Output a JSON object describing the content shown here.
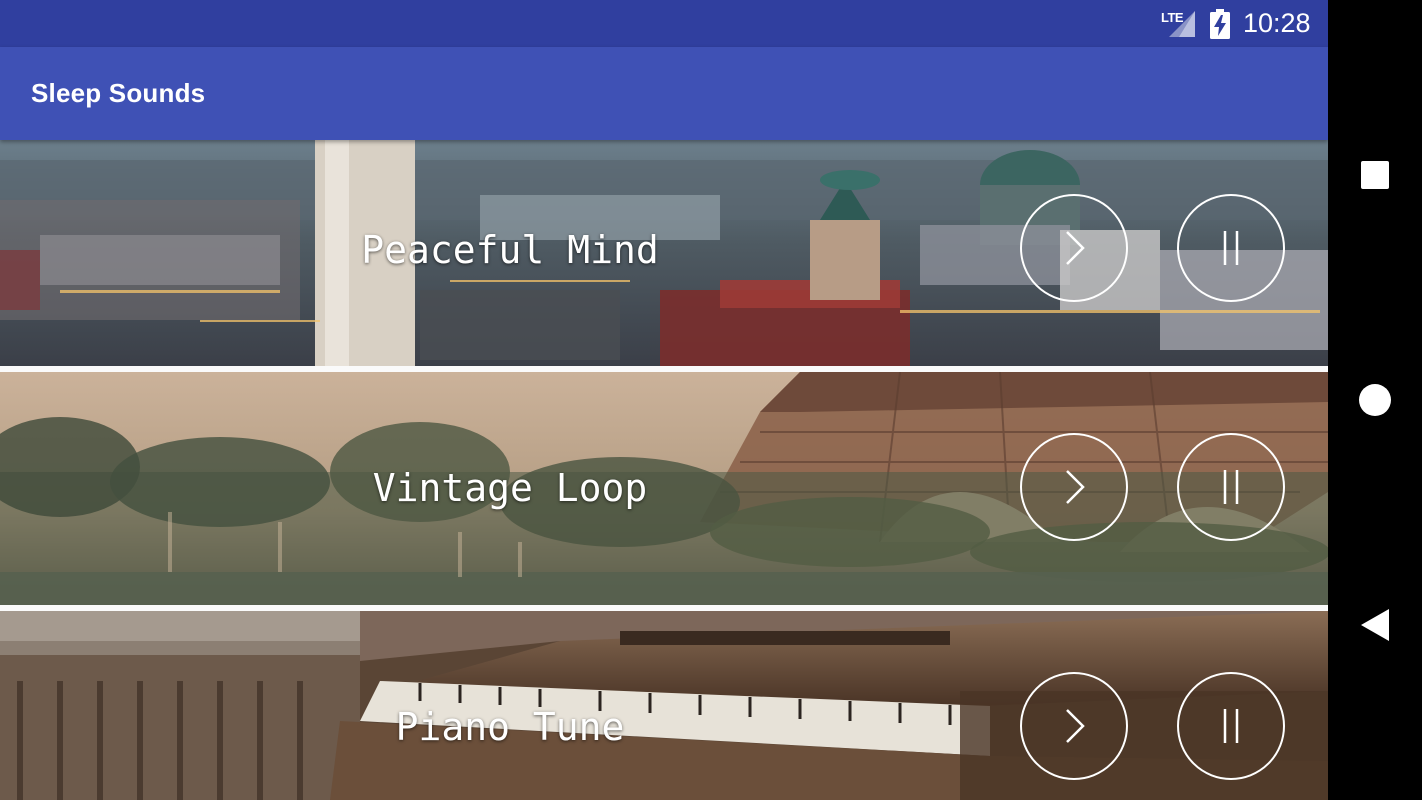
{
  "status_bar": {
    "network": "LTE",
    "time": "10:28",
    "icons": [
      "lte-signal-icon",
      "battery-charging-icon"
    ]
  },
  "app_bar": {
    "title": "Sleep Sounds"
  },
  "sounds": [
    {
      "title": "Peaceful Mind",
      "image": "city-skyline-dusk",
      "play_icon": "chevron-right-icon",
      "pause_icon": "pause-icon"
    },
    {
      "title": "Vintage Loop",
      "image": "eiffel-tower-sepia",
      "play_icon": "chevron-right-icon",
      "pause_icon": "pause-icon"
    },
    {
      "title": "Piano Tune",
      "image": "upright-piano",
      "play_icon": "chevron-right-icon",
      "pause_icon": "pause-icon"
    }
  ],
  "navigation_bar": {
    "buttons": [
      "recents-square-icon",
      "home-circle-icon",
      "back-triangle-icon"
    ]
  },
  "colors": {
    "status_bar": "#303f9f",
    "app_bar": "#3f51b5",
    "nav_bar": "#000000"
  }
}
